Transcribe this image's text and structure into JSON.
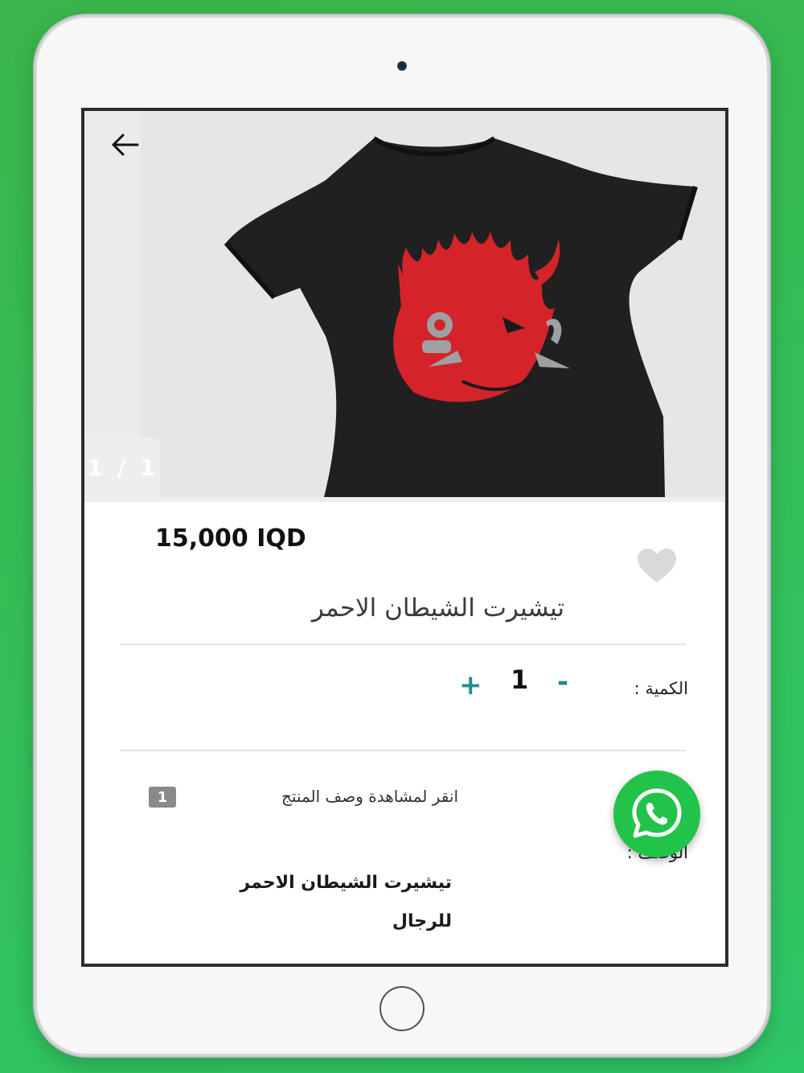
{
  "product": {
    "price": "15,000 IQD",
    "title": "تيشيرت الشيطان الاحمر",
    "image_counter": "1 / 1"
  },
  "quantity": {
    "label": "الكمية :",
    "minus": "-",
    "value": "1",
    "plus": "+"
  },
  "description": {
    "hint": "انقر لمشاهدة وصف المنتج",
    "badge": "1",
    "label": "الوصف :",
    "text": "تيشيرت الشيطان الاحمر للرجال"
  },
  "colors": {
    "accent": "#1f8f8a",
    "whatsapp": "#22c34a",
    "background": "#2ec766"
  },
  "icons": [
    "back-arrow-icon",
    "heart-icon",
    "whatsapp-icon"
  ]
}
